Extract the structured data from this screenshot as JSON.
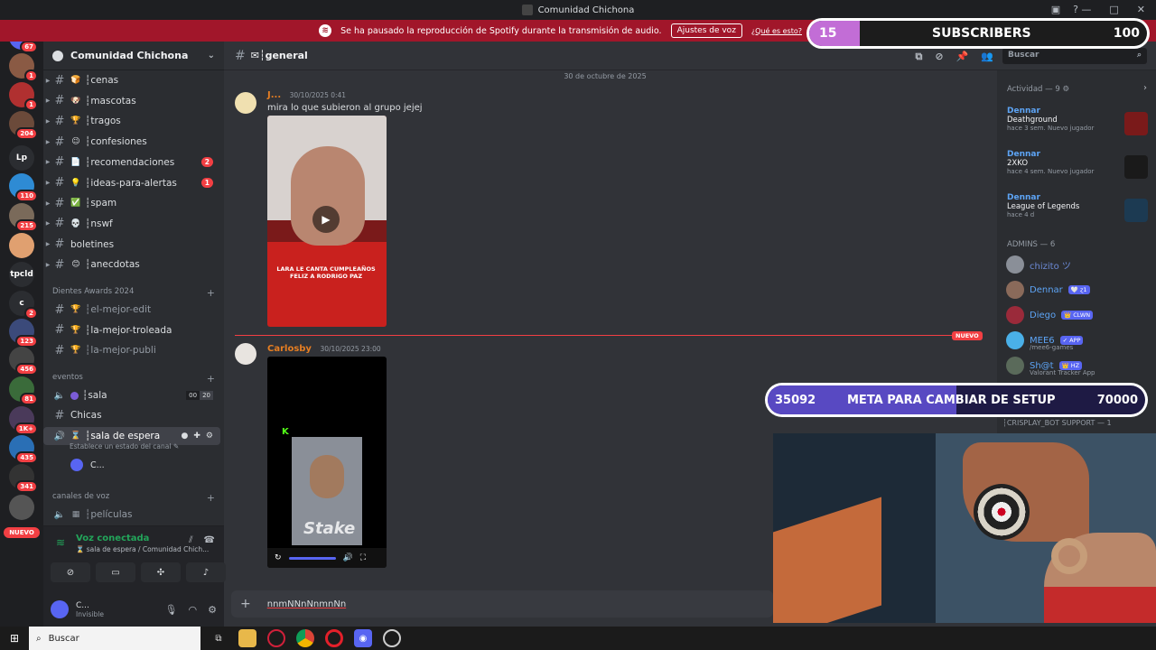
{
  "window": {
    "title": "Comunidad Chichona"
  },
  "banner": {
    "message": "Se ha pausado la reproducción de Spotify durante la transmisión de audio.",
    "voice_settings": "Ajustes de voz",
    "what_is_this": "¿Qué es esto?"
  },
  "servers": [
    {
      "label": "",
      "badge": "67",
      "color": "#5865f2"
    },
    {
      "label": "",
      "badge": "1",
      "color": "#8a5a44"
    },
    {
      "label": "",
      "badge": "1",
      "color": "#b03030"
    },
    {
      "label": "",
      "badge": "204",
      "color": "#6b4a3a"
    },
    {
      "label": "Lp",
      "badge": "",
      "color": "#2b2d31"
    },
    {
      "label": "",
      "badge": "110",
      "color": "#2e8bd4"
    },
    {
      "label": "",
      "badge": "215",
      "color": "#7a6a5a"
    },
    {
      "label": "",
      "badge": "",
      "color": "#e0a070"
    },
    {
      "label": "tpcld",
      "badge": "",
      "color": "#2b2d31"
    },
    {
      "label": "c",
      "badge": "2",
      "color": "#2b2d31"
    },
    {
      "label": "",
      "badge": "123",
      "color": "#3b4a7a"
    },
    {
      "label": "",
      "badge": "456",
      "color": "#444"
    },
    {
      "label": "",
      "badge": "81",
      "color": "#3a6b3a"
    },
    {
      "label": "",
      "badge": "1K+",
      "color": "#4a3a5a"
    },
    {
      "label": "",
      "badge": "435",
      "color": "#2a6fb5"
    },
    {
      "label": "",
      "badge": "341",
      "color": "#333"
    },
    {
      "label": "",
      "badge": "",
      "color": "#555"
    }
  ],
  "servers_new": "NUEVO",
  "guild": {
    "name": "Comunidad Chichona"
  },
  "channels": [
    {
      "icon": "🍞",
      "name": "┆cenas",
      "badge": ""
    },
    {
      "icon": "🐶",
      "name": "┆mascotas",
      "badge": ""
    },
    {
      "icon": "🏆",
      "name": "┆tragos",
      "badge": ""
    },
    {
      "icon": "😉",
      "name": "┆confesiones",
      "badge": ""
    },
    {
      "icon": "📄",
      "name": "┆recomendaciones",
      "badge": "2"
    },
    {
      "icon": "💡",
      "name": "┆ideas-para-alertas",
      "badge": "1"
    },
    {
      "icon": "✅",
      "name": "┆spam",
      "badge": ""
    },
    {
      "icon": "💀",
      "name": "┆nswf",
      "badge": ""
    },
    {
      "icon": "",
      "name": "boletines",
      "badge": ""
    },
    {
      "icon": "😊",
      "name": "┆anecdotas",
      "badge": ""
    }
  ],
  "awards_category": "Dientes Awards 2024",
  "awards_channels": [
    {
      "name": "┆el-mejor-edit",
      "muted": true
    },
    {
      "name": "┆la-mejor-troleada",
      "muted": false
    },
    {
      "name": "┆la-mejor-publi",
      "muted": true
    }
  ],
  "events_category": "eventos",
  "voice_channels": {
    "sala": "┆sala",
    "sala_counts": [
      "00",
      "20"
    ],
    "chicas": "Chicas",
    "sala_espera": "┆sala de espera",
    "status_hint": "Establece un estado del canal",
    "voice_user": "C..."
  },
  "voice_category": "canales de voz",
  "peliculas": "┆películas",
  "voice_panel": {
    "status": "Voz conectada",
    "channel": "sala de espera / Comunidad Chich...",
    "user_name": "C...",
    "user_status": "Invisible"
  },
  "chat": {
    "channel": "✉┆general",
    "search_placeholder": "Buscar",
    "date_divider": "30 de octubre de 2025",
    "new_tag": "NUEVO",
    "messages": [
      {
        "author": "J...",
        "time": "30/10/2025 0:41",
        "text": "mira lo que subieron al grupo jejej",
        "color": "#e67e22"
      },
      {
        "author": "Carlosby",
        "time": "30/10/2025 23:00",
        "text": "",
        "color": "#e67e22"
      }
    ],
    "video1_caption": "LARA LE CANTA CUMPLEAÑOS FELIZ A RODRIGO PAZ",
    "composer_text": "nnmNNnNnmnNn"
  },
  "members": {
    "activity_label": "Actividad — 9",
    "activities": [
      {
        "who": "Dennar",
        "game": "Deathground",
        "meta": "hace 3 sem.  Nuevo jugador",
        "color": "#7a1a1a"
      },
      {
        "who": "Dennar",
        "game": "2XKO",
        "meta": "hace 4 sem.  Nuevo jugador",
        "color": "#1a1a1a"
      },
      {
        "who": "Dennar",
        "game": "League of Legends",
        "meta": "hace 4 d",
        "color": "#1c3a52"
      }
    ],
    "admins_label": "ADMINS — 6",
    "admins": [
      {
        "name": "chizito ツ",
        "tag": "",
        "sub": "",
        "color": "#6c8ad6",
        "av": "#8a8f98"
      },
      {
        "name": "Dennar",
        "tag": "🤍 ɀ1",
        "sub": "",
        "color": "#5da4f5",
        "av": "#8a6a5a"
      },
      {
        "name": "Diego",
        "tag": "👑 CLWN",
        "sub": "",
        "color": "#5da4f5",
        "av": "#9a2a3a"
      },
      {
        "name": "MEE6",
        "tag": "✓ APP",
        "sub": "/mee6-games",
        "color": "#5da4f5",
        "av": "#4ab0e8"
      },
      {
        "name": "Sh@t",
        "tag": "👑 HZ",
        "sub": "Valorant Tracker App",
        "color": "#5da4f5",
        "av": "#5a6a5a"
      }
    ],
    "crisplay": "┆CRISPLAY_BOT SUPPORT — 1"
  },
  "overlays": {
    "subs_current": "15",
    "subs_label": "SUBSCRIBERS",
    "subs_goal": "100",
    "subs_progress": 0.15,
    "meta_current": "35092",
    "meta_label": "META PARA CAMBIAR DE SETUP",
    "meta_goal": "70000",
    "meta_progress": 0.5
  },
  "taskbar": {
    "search": "Buscar"
  }
}
